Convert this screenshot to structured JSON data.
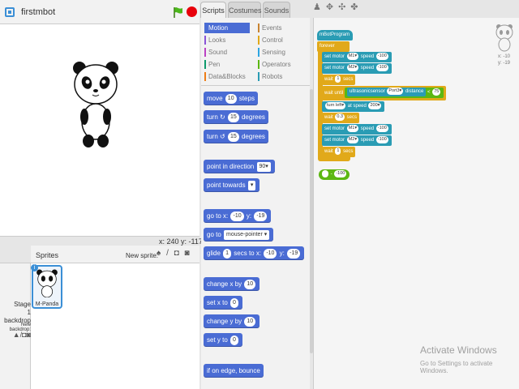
{
  "stage": {
    "project_title": "firstmbot",
    "mouse_coords": "x: 240  y: -117"
  },
  "sprites": {
    "label": "Sprites",
    "new_sprite_label": "New sprite:",
    "new_sprite_icons": "♠ / ◘ ◙",
    "stage_label": "Stage",
    "stage_backdrops": "1 backdrop",
    "new_backdrop_label": "New backdrop:",
    "backdrop_icons": "▲/◘◙",
    "selected_sprite_name": "M-Panda",
    "info_badge": "i"
  },
  "tabs": [
    {
      "label": "Scripts"
    },
    {
      "label": "Costumes"
    },
    {
      "label": "Sounds"
    }
  ],
  "toolbar_icons": "♟✥✣✤",
  "categories": [
    {
      "label": "Motion",
      "color": "#4a6cd4"
    },
    {
      "label": "Looks",
      "color": "#8a55d7"
    },
    {
      "label": "Sound",
      "color": "#bb42c3"
    },
    {
      "label": "Pen",
      "color": "#0e9a6c"
    },
    {
      "label": "Data&Blocks",
      "color": "#ee7d16"
    },
    {
      "label": "Events",
      "color": "#c88330"
    },
    {
      "label": "Control",
      "color": "#e1a91a"
    },
    {
      "label": "Sensing",
      "color": "#2ca5e2"
    },
    {
      "label": "Operators",
      "color": "#5cb712"
    },
    {
      "label": "Robots",
      "color": "#2a9cb4"
    }
  ],
  "palette": {
    "move": {
      "pre": "move",
      "val": "10",
      "post": "steps"
    },
    "turn_cw": {
      "pre": "turn ↻",
      "val": "15",
      "post": "degrees"
    },
    "turn_ccw": {
      "pre": "turn ↺",
      "val": "15",
      "post": "degrees"
    },
    "point_direction": {
      "pre": "point in direction",
      "val": "90▾"
    },
    "point_towards": {
      "pre": "point towards",
      "val": "▾"
    },
    "goto_xy": {
      "pre": "go to x:",
      "x": "-10",
      "mid": "y:",
      "y": "-19"
    },
    "goto": {
      "pre": "go to",
      "val": "mouse-pointer ▾"
    },
    "glide": {
      "pre": "glide",
      "secs": "1",
      "mid": "secs to x:",
      "x": "-10",
      "mid2": "y:",
      "y": "-19"
    },
    "change_x": {
      "pre": "change x by",
      "val": "10"
    },
    "set_x": {
      "pre": "set x to",
      "val": "0"
    },
    "change_y": {
      "pre": "change y by",
      "val": "10"
    },
    "set_y": {
      "pre": "set y to",
      "val": "0"
    },
    "bounce": {
      "label": "if on edge, bounce"
    }
  },
  "script": {
    "hat": "mBotProgram",
    "forever": "forever",
    "motor1a": {
      "pre": "set motor",
      "port": "M1▾",
      "mid": "speed",
      "val": "-100"
    },
    "motor2a": {
      "pre": "set motor",
      "port": "M2▾",
      "mid": "speed",
      "val": "-100"
    },
    "wait1": {
      "pre": "wait",
      "val": "1",
      "post": "secs"
    },
    "wait_until": {
      "pre": "wait until",
      "sensor": "ultrasonicsensor",
      "port": "Port3▾",
      "mid": "distance",
      "op": "<",
      "val": "75"
    },
    "turn": {
      "pre": "turn left▾",
      "mid": "at speed",
      "val": "200▾"
    },
    "wait2": {
      "pre": "wait",
      "val": "0.3",
      "post": "secs"
    },
    "motor1b": {
      "pre": "set motor",
      "port": "M1▾",
      "mid": "speed",
      "val": "-100"
    },
    "motor2b": {
      "pre": "set motor",
      "port": "M2▾",
      "mid": "speed",
      "val": "-100"
    },
    "wait3": {
      "pre": "wait",
      "val": "1",
      "post": "secs"
    },
    "loose_reporter": {
      "op": "-",
      "val": "-100"
    }
  },
  "sprite_corner_xy": {
    "x": "x: -10",
    "y": "y: -19"
  },
  "watermark": {
    "title": "Activate Windows",
    "subtitle": "Go to Settings to activate Windows."
  }
}
